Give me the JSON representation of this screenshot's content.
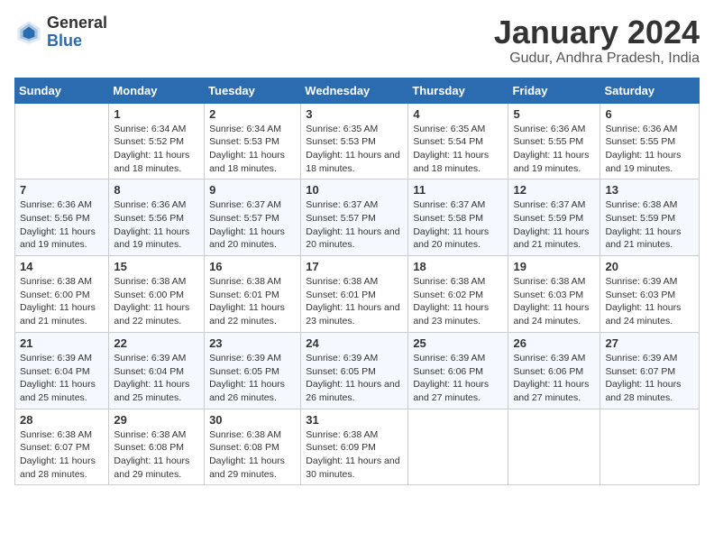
{
  "logo": {
    "general": "General",
    "blue": "Blue"
  },
  "title": "January 2024",
  "subtitle": "Gudur, Andhra Pradesh, India",
  "days_header": [
    "Sunday",
    "Monday",
    "Tuesday",
    "Wednesday",
    "Thursday",
    "Friday",
    "Saturday"
  ],
  "weeks": [
    [
      {
        "day": "",
        "sunrise": "",
        "sunset": "",
        "daylight": ""
      },
      {
        "day": "1",
        "sunrise": "Sunrise: 6:34 AM",
        "sunset": "Sunset: 5:52 PM",
        "daylight": "Daylight: 11 hours and 18 minutes."
      },
      {
        "day": "2",
        "sunrise": "Sunrise: 6:34 AM",
        "sunset": "Sunset: 5:53 PM",
        "daylight": "Daylight: 11 hours and 18 minutes."
      },
      {
        "day": "3",
        "sunrise": "Sunrise: 6:35 AM",
        "sunset": "Sunset: 5:53 PM",
        "daylight": "Daylight: 11 hours and 18 minutes."
      },
      {
        "day": "4",
        "sunrise": "Sunrise: 6:35 AM",
        "sunset": "Sunset: 5:54 PM",
        "daylight": "Daylight: 11 hours and 18 minutes."
      },
      {
        "day": "5",
        "sunrise": "Sunrise: 6:36 AM",
        "sunset": "Sunset: 5:55 PM",
        "daylight": "Daylight: 11 hours and 19 minutes."
      },
      {
        "day": "6",
        "sunrise": "Sunrise: 6:36 AM",
        "sunset": "Sunset: 5:55 PM",
        "daylight": "Daylight: 11 hours and 19 minutes."
      }
    ],
    [
      {
        "day": "7",
        "sunrise": "Sunrise: 6:36 AM",
        "sunset": "Sunset: 5:56 PM",
        "daylight": "Daylight: 11 hours and 19 minutes."
      },
      {
        "day": "8",
        "sunrise": "Sunrise: 6:36 AM",
        "sunset": "Sunset: 5:56 PM",
        "daylight": "Daylight: 11 hours and 19 minutes."
      },
      {
        "day": "9",
        "sunrise": "Sunrise: 6:37 AM",
        "sunset": "Sunset: 5:57 PM",
        "daylight": "Daylight: 11 hours and 20 minutes."
      },
      {
        "day": "10",
        "sunrise": "Sunrise: 6:37 AM",
        "sunset": "Sunset: 5:57 PM",
        "daylight": "Daylight: 11 hours and 20 minutes."
      },
      {
        "day": "11",
        "sunrise": "Sunrise: 6:37 AM",
        "sunset": "Sunset: 5:58 PM",
        "daylight": "Daylight: 11 hours and 20 minutes."
      },
      {
        "day": "12",
        "sunrise": "Sunrise: 6:37 AM",
        "sunset": "Sunset: 5:59 PM",
        "daylight": "Daylight: 11 hours and 21 minutes."
      },
      {
        "day": "13",
        "sunrise": "Sunrise: 6:38 AM",
        "sunset": "Sunset: 5:59 PM",
        "daylight": "Daylight: 11 hours and 21 minutes."
      }
    ],
    [
      {
        "day": "14",
        "sunrise": "Sunrise: 6:38 AM",
        "sunset": "Sunset: 6:00 PM",
        "daylight": "Daylight: 11 hours and 21 minutes."
      },
      {
        "day": "15",
        "sunrise": "Sunrise: 6:38 AM",
        "sunset": "Sunset: 6:00 PM",
        "daylight": "Daylight: 11 hours and 22 minutes."
      },
      {
        "day": "16",
        "sunrise": "Sunrise: 6:38 AM",
        "sunset": "Sunset: 6:01 PM",
        "daylight": "Daylight: 11 hours and 22 minutes."
      },
      {
        "day": "17",
        "sunrise": "Sunrise: 6:38 AM",
        "sunset": "Sunset: 6:01 PM",
        "daylight": "Daylight: 11 hours and 23 minutes."
      },
      {
        "day": "18",
        "sunrise": "Sunrise: 6:38 AM",
        "sunset": "Sunset: 6:02 PM",
        "daylight": "Daylight: 11 hours and 23 minutes."
      },
      {
        "day": "19",
        "sunrise": "Sunrise: 6:38 AM",
        "sunset": "Sunset: 6:03 PM",
        "daylight": "Daylight: 11 hours and 24 minutes."
      },
      {
        "day": "20",
        "sunrise": "Sunrise: 6:39 AM",
        "sunset": "Sunset: 6:03 PM",
        "daylight": "Daylight: 11 hours and 24 minutes."
      }
    ],
    [
      {
        "day": "21",
        "sunrise": "Sunrise: 6:39 AM",
        "sunset": "Sunset: 6:04 PM",
        "daylight": "Daylight: 11 hours and 25 minutes."
      },
      {
        "day": "22",
        "sunrise": "Sunrise: 6:39 AM",
        "sunset": "Sunset: 6:04 PM",
        "daylight": "Daylight: 11 hours and 25 minutes."
      },
      {
        "day": "23",
        "sunrise": "Sunrise: 6:39 AM",
        "sunset": "Sunset: 6:05 PM",
        "daylight": "Daylight: 11 hours and 26 minutes."
      },
      {
        "day": "24",
        "sunrise": "Sunrise: 6:39 AM",
        "sunset": "Sunset: 6:05 PM",
        "daylight": "Daylight: 11 hours and 26 minutes."
      },
      {
        "day": "25",
        "sunrise": "Sunrise: 6:39 AM",
        "sunset": "Sunset: 6:06 PM",
        "daylight": "Daylight: 11 hours and 27 minutes."
      },
      {
        "day": "26",
        "sunrise": "Sunrise: 6:39 AM",
        "sunset": "Sunset: 6:06 PM",
        "daylight": "Daylight: 11 hours and 27 minutes."
      },
      {
        "day": "27",
        "sunrise": "Sunrise: 6:39 AM",
        "sunset": "Sunset: 6:07 PM",
        "daylight": "Daylight: 11 hours and 28 minutes."
      }
    ],
    [
      {
        "day": "28",
        "sunrise": "Sunrise: 6:38 AM",
        "sunset": "Sunset: 6:07 PM",
        "daylight": "Daylight: 11 hours and 28 minutes."
      },
      {
        "day": "29",
        "sunrise": "Sunrise: 6:38 AM",
        "sunset": "Sunset: 6:08 PM",
        "daylight": "Daylight: 11 hours and 29 minutes."
      },
      {
        "day": "30",
        "sunrise": "Sunrise: 6:38 AM",
        "sunset": "Sunset: 6:08 PM",
        "daylight": "Daylight: 11 hours and 29 minutes."
      },
      {
        "day": "31",
        "sunrise": "Sunrise: 6:38 AM",
        "sunset": "Sunset: 6:09 PM",
        "daylight": "Daylight: 11 hours and 30 minutes."
      },
      {
        "day": "",
        "sunrise": "",
        "sunset": "",
        "daylight": ""
      },
      {
        "day": "",
        "sunrise": "",
        "sunset": "",
        "daylight": ""
      },
      {
        "day": "",
        "sunrise": "",
        "sunset": "",
        "daylight": ""
      }
    ]
  ]
}
